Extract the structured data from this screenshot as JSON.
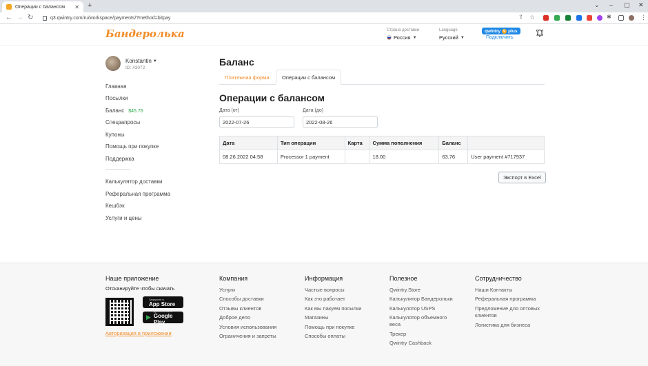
{
  "browser": {
    "tab_title": "Операции с балансом",
    "url": "q3.qwintry.com/ru/workspace/payments/?method=bitpay"
  },
  "header": {
    "logo": "Бандеролька",
    "country_label": "Страна доставки",
    "country_value": "Россия",
    "language_label": "Language",
    "language_value": "Русский",
    "plus_badge": "qwintry",
    "plus_word": "plus",
    "connect": "Подключить"
  },
  "user": {
    "name": "Konstantin",
    "id": "ID: #3072"
  },
  "sidebar": {
    "items": [
      {
        "label": "Главная"
      },
      {
        "label": "Посылки"
      },
      {
        "label": "Баланс",
        "badge": "$45.76"
      },
      {
        "label": "Спецзапросы"
      },
      {
        "label": "Купоны"
      },
      {
        "label": "Помощь при покупке"
      },
      {
        "label": "Поддержка"
      }
    ],
    "items2": [
      {
        "label": "Калькулятор доставки"
      },
      {
        "label": "Реферальная программа"
      },
      {
        "label": "Кешбэк"
      },
      {
        "label": "Услуги и цены"
      }
    ]
  },
  "main": {
    "title": "Баланс",
    "tabs": [
      {
        "label": "Платежная форма"
      },
      {
        "label": "Операции с балансом"
      }
    ],
    "section_title": "Операции с балансом",
    "date_from_label": "Дата (от)",
    "date_from_value": "2022-07-26",
    "date_to_label": "Дата (до)",
    "date_to_value": "2022-08-26",
    "table": {
      "headers": [
        "Дата",
        "Тип операции",
        "Карта",
        "Сумма пополнения",
        "Баланс",
        ""
      ],
      "rows": [
        [
          "08.26.2022 04:58",
          "Processor 1 payment",
          "",
          "18.00",
          "63.76",
          "User payment #717937"
        ]
      ]
    },
    "export_label": "Экспорт в Excel"
  },
  "footer": {
    "app_title": "Наше приложение",
    "app_sub": "Отсканируйте чтобы скачать",
    "appstore_small": "Загрузите в",
    "appstore_big": "App Store",
    "gplay_small": "ДОСТУПНО В",
    "gplay_big": "Google Play",
    "auth_link": "Авторизация в приложении",
    "columns": [
      {
        "title": "Компания",
        "links": [
          "Услуги",
          "Способы доставки",
          "Отзывы клиентов",
          "Доброе дело",
          "Условия использования",
          "Ограничения и запреты"
        ]
      },
      {
        "title": "Информация",
        "links": [
          "Частые вопросы",
          "Как это работает",
          "Как мы пакуем посылки",
          "Магазины",
          "Помощь при покупке",
          "Способы оплаты"
        ]
      },
      {
        "title": "Полезное",
        "links": [
          "Qwintry.Store",
          "Калькулятор Бандерольки",
          "Калькулятор USPS",
          "Калькулятор объемного веса",
          "Трекер",
          "Qwintry Cashback"
        ]
      },
      {
        "title": "Сотрудничество",
        "links": [
          "Наши Контакты",
          "Реферальная программа",
          "Предложение для оптовых клиентов",
          "Логистика для бизнеса"
        ]
      }
    ]
  },
  "colors": {
    "brand": "#f28c28",
    "link_blue": "#1e88e5",
    "balance_green": "#28a745"
  }
}
